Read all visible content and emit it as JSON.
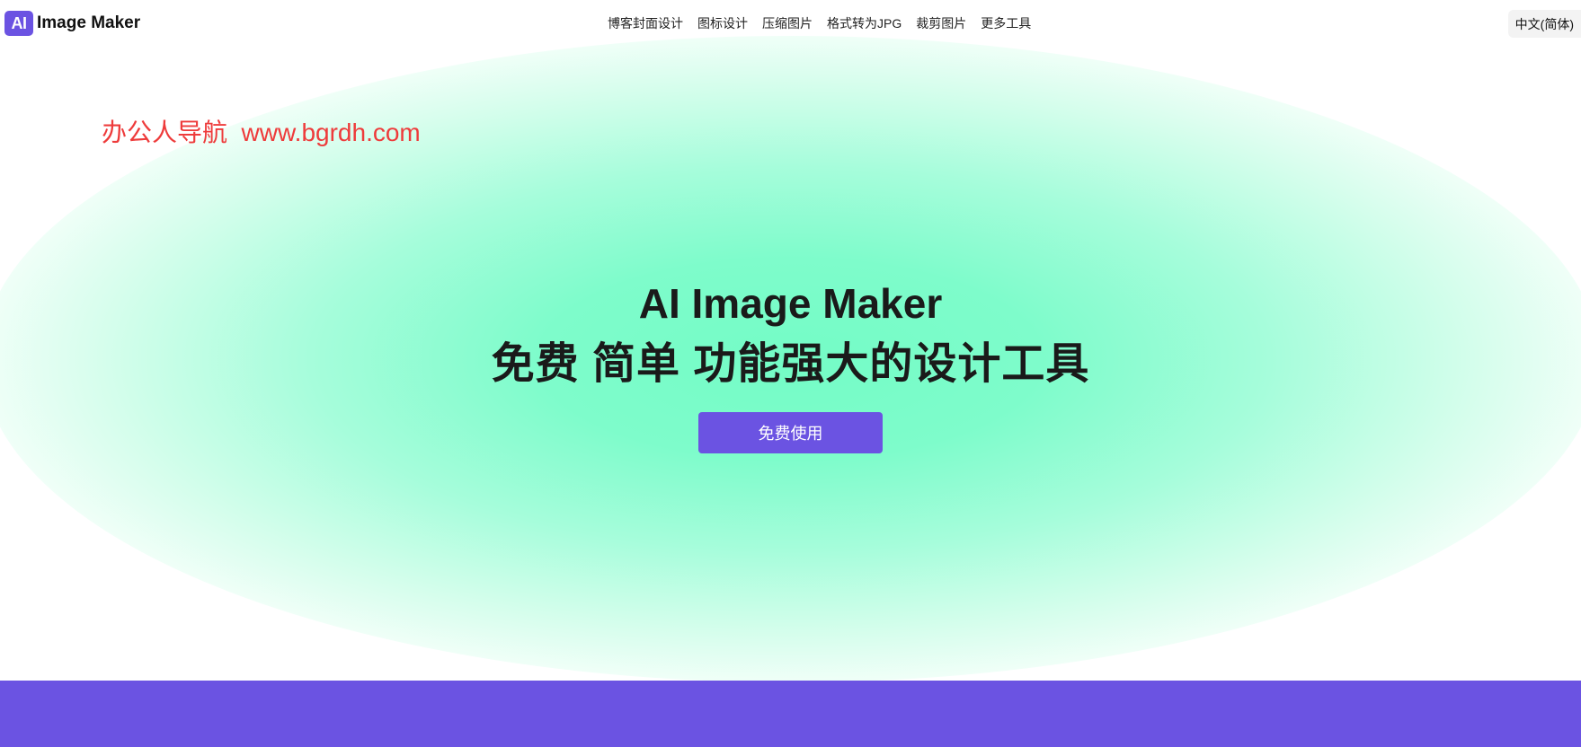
{
  "colors": {
    "accent": "#6b53e2",
    "glow": "#74fcc6",
    "watermark": "#ee3b3b"
  },
  "header": {
    "logo_badge": "AI",
    "logo_text": "Image Maker",
    "nav": [
      {
        "label": "博客封面设计"
      },
      {
        "label": "图标设计"
      },
      {
        "label": "压缩图片"
      },
      {
        "label": "格式转为JPG"
      },
      {
        "label": "裁剪图片"
      },
      {
        "label": "更多工具"
      }
    ],
    "language": "中文(简体)"
  },
  "watermark": "办公人导航  www.bgrdh.com",
  "hero": {
    "title": "AI Image Maker",
    "subtitle": "免费 简单 功能强大的设计工具",
    "cta_label": "免费使用"
  }
}
